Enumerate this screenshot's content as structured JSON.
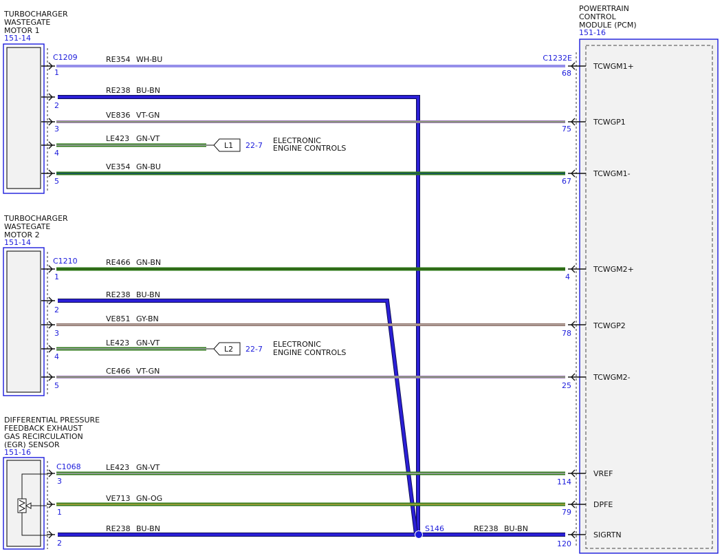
{
  "components": {
    "tcwg1": {
      "name_lines": [
        "TURBOCHARGER",
        "WASTEGATE",
        "MOTOR 1"
      ],
      "ref": "151-14",
      "connector": "C1209"
    },
    "tcwg2": {
      "name_lines": [
        "TURBOCHARGER",
        "WASTEGATE",
        "MOTOR 2"
      ],
      "ref": "151-14",
      "connector": "C1210"
    },
    "dpfe": {
      "name_lines": [
        "DIFFERENTIAL PRESSURE",
        "FEEDBACK EXHAUST",
        "GAS RECIRCULATION",
        "(EGR) SENSOR"
      ],
      "ref": "151-16",
      "connector": "C1068"
    },
    "pcm": {
      "name_lines": [
        "POWERTRAIN",
        "CONTROL",
        "MODULE (PCM)"
      ],
      "ref": "151-16",
      "connector": "C1232E"
    }
  },
  "wires": {
    "m1_p1": {
      "circuit": "RE354",
      "color_code": "WH-BU",
      "left_pin": "1",
      "right_pin": "68",
      "signal": "TCWGM1+"
    },
    "m1_p2": {
      "circuit": "RE238",
      "color_code": "BU-BN",
      "left_pin": "2"
    },
    "m1_p3": {
      "circuit": "VE836",
      "color_code": "VT-GN",
      "left_pin": "3",
      "right_pin": "75",
      "signal": "TCWGP1"
    },
    "m1_p4": {
      "circuit": "LE423",
      "color_code": "GN-VT",
      "left_pin": "4",
      "ref_tag": "L1",
      "ref_page": "22-7",
      "ref_desc_lines": [
        "ELECTRONIC",
        "ENGINE CONTROLS"
      ]
    },
    "m1_p5": {
      "circuit": "VE354",
      "color_code": "GN-BU",
      "left_pin": "5",
      "right_pin": "67",
      "signal": "TCWGM1-"
    },
    "m2_p1": {
      "circuit": "RE466",
      "color_code": "GN-BN",
      "left_pin": "1",
      "right_pin": "4",
      "signal": "TCWGM2+"
    },
    "m2_p2": {
      "circuit": "RE238",
      "color_code": "BU-BN",
      "left_pin": "2"
    },
    "m2_p3": {
      "circuit": "VE851",
      "color_code": "GY-BN",
      "left_pin": "3",
      "right_pin": "78",
      "signal": "TCWGP2"
    },
    "m2_p4": {
      "circuit": "LE423",
      "color_code": "GN-VT",
      "left_pin": "4",
      "ref_tag": "L2",
      "ref_page": "22-7",
      "ref_desc_lines": [
        "ELECTRONIC",
        "ENGINE CONTROLS"
      ]
    },
    "m2_p5": {
      "circuit": "CE466",
      "color_code": "VT-GN",
      "left_pin": "5",
      "right_pin": "25",
      "signal": "TCWGM2-"
    },
    "s_p3": {
      "circuit": "LE423",
      "color_code": "GN-VT",
      "left_pin": "3",
      "right_pin": "114",
      "signal": "VREF"
    },
    "s_p1": {
      "circuit": "VE713",
      "color_code": "GN-OG",
      "left_pin": "1",
      "right_pin": "79",
      "signal": "DPFE"
    },
    "s_p2": {
      "circuit": "RE238",
      "color_code": "BU-BN",
      "left_pin": "2"
    },
    "s_out": {
      "circuit": "RE238",
      "color_code": "BU-BN",
      "right_pin": "120",
      "signal": "SIGRTN"
    }
  },
  "splice": {
    "id": "S146"
  },
  "colors": {
    "blue_label": "#1a1adb",
    "wire_bu": "#2b1fd6",
    "wire_gn": "#2f7a1a",
    "wire_gn_light": "#7ec242",
    "wire_vt": "#9a74b4",
    "wire_wh_bu": "#8c8ce6",
    "wire_gy_bn": "#8a6e66",
    "wire_teal": "#1b5a57",
    "module_fill": "#f2f2f2"
  }
}
